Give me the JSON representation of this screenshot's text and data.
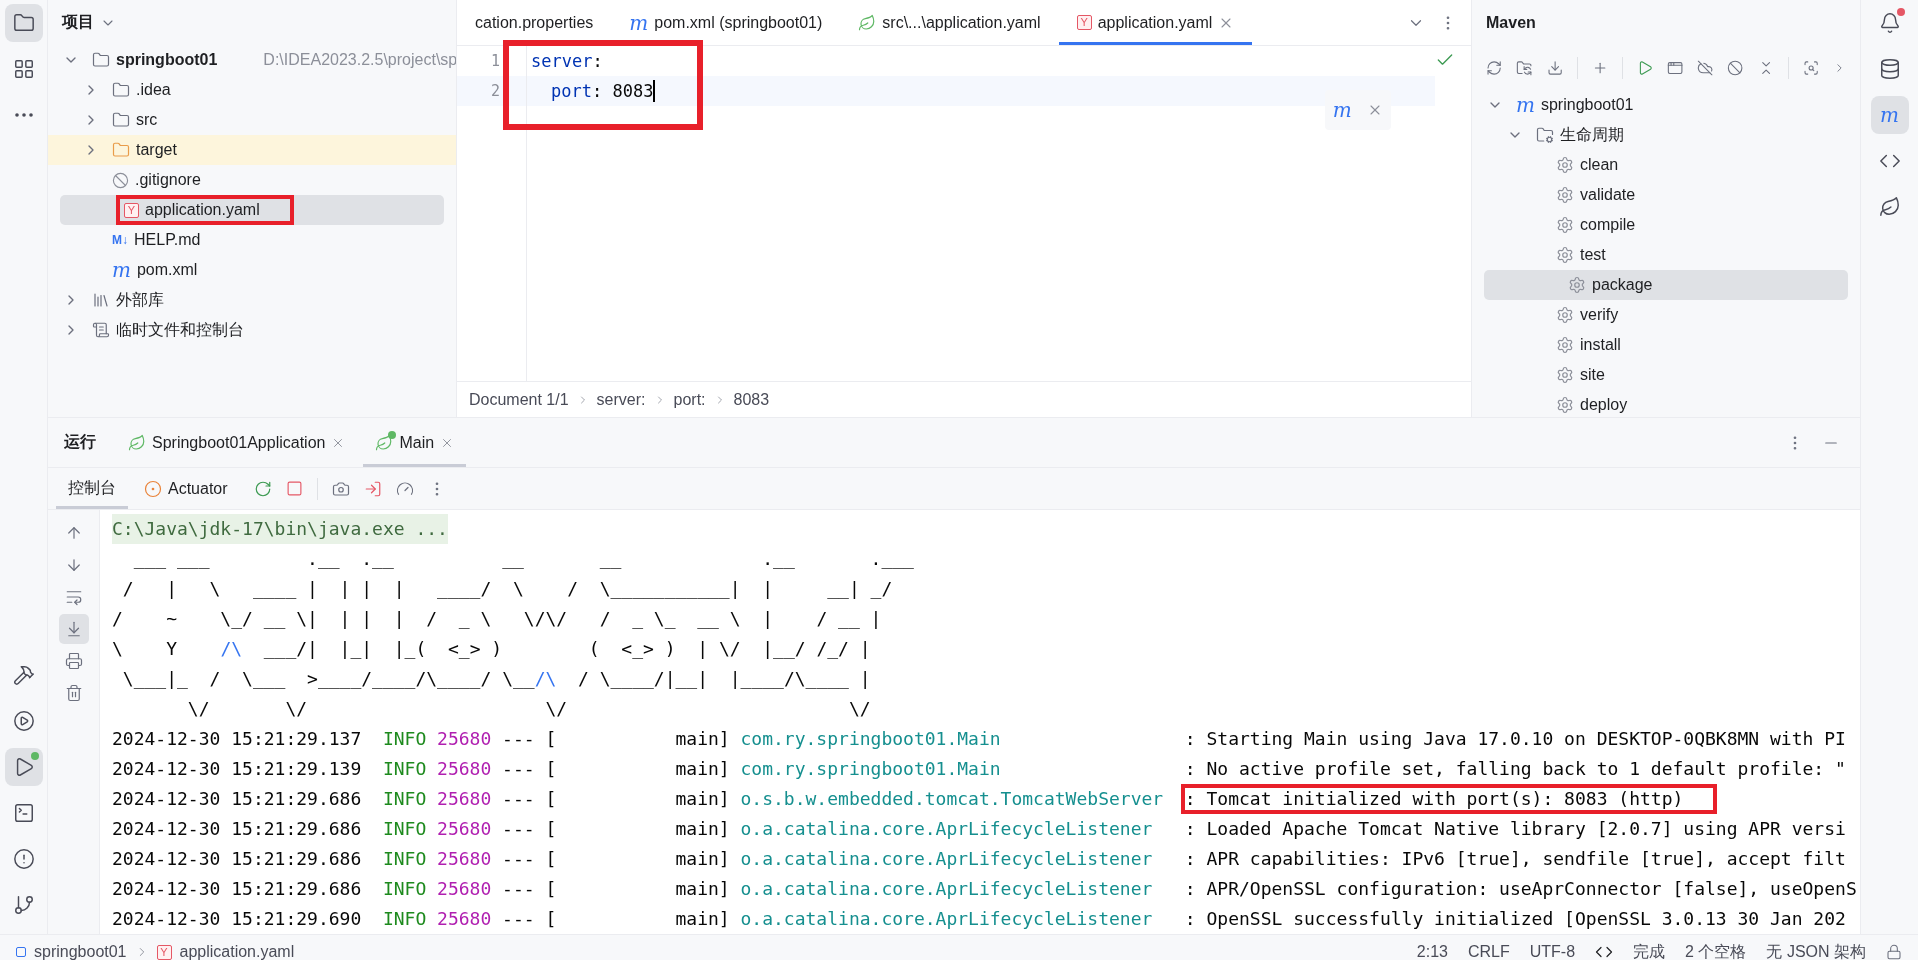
{
  "left_toolbar": {
    "top": [
      {
        "kind": "project",
        "selected": true,
        "badge": false
      },
      {
        "kind": "structure",
        "selected": false,
        "badge": false
      },
      {
        "kind": "more",
        "selected": false,
        "badge": false
      }
    ],
    "bottom": [
      {
        "kind": "build",
        "selected": false,
        "badge": false
      },
      {
        "kind": "services",
        "selected": false,
        "badge": false
      },
      {
        "kind": "run",
        "selected": true,
        "badge": true
      },
      {
        "kind": "terminal",
        "selected": false,
        "badge": false
      },
      {
        "kind": "problems",
        "selected": false,
        "badge": false
      },
      {
        "kind": "git",
        "selected": false,
        "badge": false
      }
    ]
  },
  "project": {
    "title": "项目",
    "tree": [
      {
        "label": "springboot01",
        "path": "D:\\IDEA2023.2.5\\project\\sp",
        "kind": "module",
        "expanded": true,
        "selected": false,
        "highlighted": false,
        "children": [
          {
            "label": ".idea",
            "kind": "folder",
            "expanded": false,
            "selected": false,
            "highlighted": false
          },
          {
            "label": "src",
            "kind": "folder",
            "expanded": false,
            "selected": false,
            "highlighted": false
          },
          {
            "label": "target",
            "kind": "excluded-folder",
            "expanded": false,
            "selected": false,
            "highlighted": false
          },
          {
            "label": ".gitignore",
            "kind": "ignore",
            "selected": false,
            "highlighted": false
          },
          {
            "label": "application.yaml",
            "kind": "yaml",
            "icon_text": "Y",
            "selected": true,
            "highlighted": true
          },
          {
            "label": "HELP.md",
            "kind": "markdown",
            "icon_text": "M↓",
            "selected": false,
            "highlighted": false
          },
          {
            "label": "pom.xml",
            "kind": "maven",
            "icon_text": "m",
            "selected": false,
            "highlighted": false
          }
        ]
      },
      {
        "label": "外部库",
        "kind": "library",
        "expanded": false,
        "selected": false,
        "highlighted": false
      },
      {
        "label": "临时文件和控制台",
        "kind": "scratch",
        "expanded": false,
        "selected": false,
        "highlighted": false
      }
    ]
  },
  "editor": {
    "tabs": [
      {
        "label": "cation.properties",
        "kind": "properties",
        "selected": false
      },
      {
        "label": "pom.xml (springboot01)",
        "kind": "maven",
        "icon_text": "m",
        "selected": false
      },
      {
        "label": "src\\...\\application.yaml",
        "kind": "spring",
        "selected": false
      },
      {
        "label": "application.yaml",
        "kind": "yaml",
        "icon_text": "Y",
        "selected": true
      }
    ],
    "highlighted": true,
    "lines": [
      {
        "number": "1",
        "key": "server",
        "separator": ":",
        "current": false,
        "children": [
          {
            "number": "2",
            "key": "port",
            "separator": ":",
            "value": "8083",
            "current": true
          }
        ]
      }
    ],
    "popup": {
      "icon_text": "m"
    },
    "breadcrumbs": [
      "Document 1/1",
      "server:",
      "port:",
      "8083"
    ]
  },
  "maven": {
    "title": "Maven",
    "tree": [
      {
        "label": "springboot01",
        "kind": "maven",
        "icon_text": "m",
        "expanded": true,
        "selected": false,
        "children": [
          {
            "label": "生命周期",
            "kind": "lifecycle",
            "expanded": true,
            "selected": false,
            "children": [
              {
                "label": "clean",
                "kind": "goal",
                "selected": false
              },
              {
                "label": "validate",
                "kind": "goal",
                "selected": false
              },
              {
                "label": "compile",
                "kind": "goal",
                "selected": false
              },
              {
                "label": "test",
                "kind": "goal",
                "selected": false
              },
              {
                "label": "package",
                "kind": "goal",
                "selected": true
              },
              {
                "label": "verify",
                "kind": "goal",
                "selected": false
              },
              {
                "label": "install",
                "kind": "goal",
                "selected": false
              },
              {
                "label": "site",
                "kind": "goal",
                "selected": false
              },
              {
                "label": "deploy",
                "kind": "goal",
                "selected": false
              }
            ]
          }
        ]
      }
    ]
  },
  "right_toolbar": [
    {
      "kind": "notifications",
      "selected": false,
      "badge": true
    },
    {
      "kind": "database",
      "selected": false,
      "badge": false
    },
    {
      "kind": "maven",
      "icon_text": "m",
      "selected": true,
      "badge": false
    },
    {
      "kind": "code-with-me",
      "selected": false,
      "badge": false
    },
    {
      "kind": "spring",
      "selected": false,
      "badge": false
    }
  ],
  "run": {
    "title": "运行",
    "tabs": [
      {
        "label": "Springboot01Application",
        "selected": false,
        "running": false
      },
      {
        "label": "Main",
        "selected": true,
        "running": true
      }
    ],
    "subtabs": [
      {
        "label": "控制台",
        "kind": "console",
        "selected": true
      },
      {
        "label": "Actuator",
        "kind": "actuator",
        "selected": false
      }
    ],
    "side_tools": [
      {
        "kind": "up",
        "selected": false
      },
      {
        "kind": "down",
        "selected": false
      },
      {
        "kind": "wrap",
        "selected": false
      },
      {
        "kind": "scroll-end",
        "selected": true
      },
      {
        "kind": "print",
        "selected": false
      },
      {
        "kind": "clear",
        "selected": false
      }
    ],
    "command": "C:\\Java\\jdk-17\\bin\\java.exe ...",
    "banner": [
      [
        {
          "text": "  ___ ___         .__  .__          __       __             .__       .___",
          "kind": "plain"
        }
      ],
      [
        {
          "text": " /   |   \\   ____ |  | |  |   ____/  \\    /  \\___________|  |     __| _/",
          "kind": "plain"
        }
      ],
      [
        {
          "text": "/    ~    \\_/ __ \\|  | |  |  /  _ \\   \\/\\/   /  _ \\_  __ \\  |    / __ |",
          "kind": "plain"
        }
      ],
      [
        {
          "text": "\\    Y    ",
          "kind": "plain"
        },
        {
          "text": "/\\",
          "kind": "accent"
        },
        {
          "text": "  ___/|  |_|  |_(  <_> )        (  <_> )  | \\/  |__/ /_/ |",
          "kind": "plain"
        }
      ],
      [
        {
          "text": " \\___|_  /  \\___  >____/____/\\____/ \\__",
          "kind": "plain"
        },
        {
          "text": "/\\",
          "kind": "accent"
        },
        {
          "text": "  / \\____/|__|  |____/\\____ |",
          "kind": "plain"
        }
      ],
      [
        {
          "text": "       \\/       \\/                      \\/                          \\/",
          "kind": "plain"
        }
      ]
    ],
    "logs": [
      {
        "timestamp": "2024-12-30 15:21:29.137",
        "level": "INFO",
        "pid": "25680",
        "separator": "---",
        "thread": "[           main]",
        "logger": "com.ry.springboot01.Main",
        "message": ": Starting Main using Java 17.0.10 on DESKTOP-0QBK8MN with PI",
        "highlighted": false
      },
      {
        "timestamp": "2024-12-30 15:21:29.139",
        "level": "INFO",
        "pid": "25680",
        "separator": "---",
        "thread": "[           main]",
        "logger": "com.ry.springboot01.Main",
        "message": ": No active profile set, falling back to 1 default profile: \"",
        "highlighted": false
      },
      {
        "timestamp": "2024-12-30 15:21:29.686",
        "level": "INFO",
        "pid": "25680",
        "separator": "---",
        "thread": "[           main]",
        "logger": "o.s.b.w.embedded.tomcat.TomcatWebServer",
        "message": ": Tomcat initialized with port(s): 8083 (http)",
        "highlighted": true
      },
      {
        "timestamp": "2024-12-30 15:21:29.686",
        "level": "INFO",
        "pid": "25680",
        "separator": "---",
        "thread": "[           main]",
        "logger": "o.a.catalina.core.AprLifecycleListener",
        "message": ": Loaded Apache Tomcat Native library [2.0.7] using APR versi",
        "highlighted": false
      },
      {
        "timestamp": "2024-12-30 15:21:29.686",
        "level": "INFO",
        "pid": "25680",
        "separator": "---",
        "thread": "[           main]",
        "logger": "o.a.catalina.core.AprLifecycleListener",
        "message": ": APR capabilities: IPv6 [true], sendfile [true], accept filt",
        "highlighted": false
      },
      {
        "timestamp": "2024-12-30 15:21:29.686",
        "level": "INFO",
        "pid": "25680",
        "separator": "---",
        "thread": "[           main]",
        "logger": "o.a.catalina.core.AprLifecycleListener",
        "message": ": APR/OpenSSL configuration: useAprConnector [false], useOpenS",
        "highlighted": false
      },
      {
        "timestamp": "2024-12-30 15:21:29.690",
        "level": "INFO",
        "pid": "25680",
        "separator": "---",
        "thread": "[           main]",
        "logger": "o.a.catalina.core.AprLifecycleListener",
        "message": ": OpenSSL successfully initialized [OpenSSL 3.0.13 30 Jan 202",
        "highlighted": false
      }
    ]
  },
  "status_bar": {
    "breadcrumbs": [
      {
        "label": "springboot01",
        "kind": "module"
      },
      {
        "label": "application.yaml",
        "kind": "yaml",
        "icon_text": "Y"
      }
    ],
    "items": [
      {
        "text": "2:13",
        "kind": "text"
      },
      {
        "text": "CRLF",
        "kind": "text"
      },
      {
        "text": "UTF-8",
        "kind": "text"
      },
      {
        "text": "完成",
        "kind": "code-with-me"
      },
      {
        "text": "2 个空格",
        "kind": "text"
      },
      {
        "text": "无 JSON 架构",
        "kind": "text"
      }
    ]
  }
}
